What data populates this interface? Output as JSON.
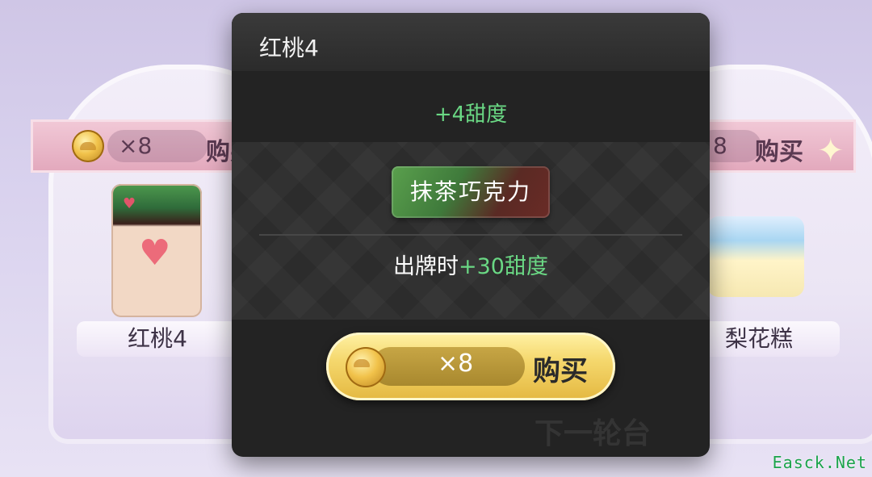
{
  "background": {
    "left_card": {
      "price": "×8",
      "buy_label": "购买",
      "name": "红桃4"
    },
    "right_card": {
      "price": "8",
      "buy_label": "购买",
      "name": "梨花糕"
    }
  },
  "modal": {
    "title": "红桃4",
    "bonus": "+4甜度",
    "tag": "抹茶巧克力",
    "effect_prefix": "出牌时",
    "effect_value": "+30甜度",
    "buy_button": {
      "quantity": "×8",
      "label": "购买"
    },
    "behind_text": "下一轮台"
  },
  "watermark": "Easck.Net",
  "colors": {
    "green_accent": "#6ad884",
    "gold": "#f5d86e",
    "modal_bg": "#232323"
  }
}
